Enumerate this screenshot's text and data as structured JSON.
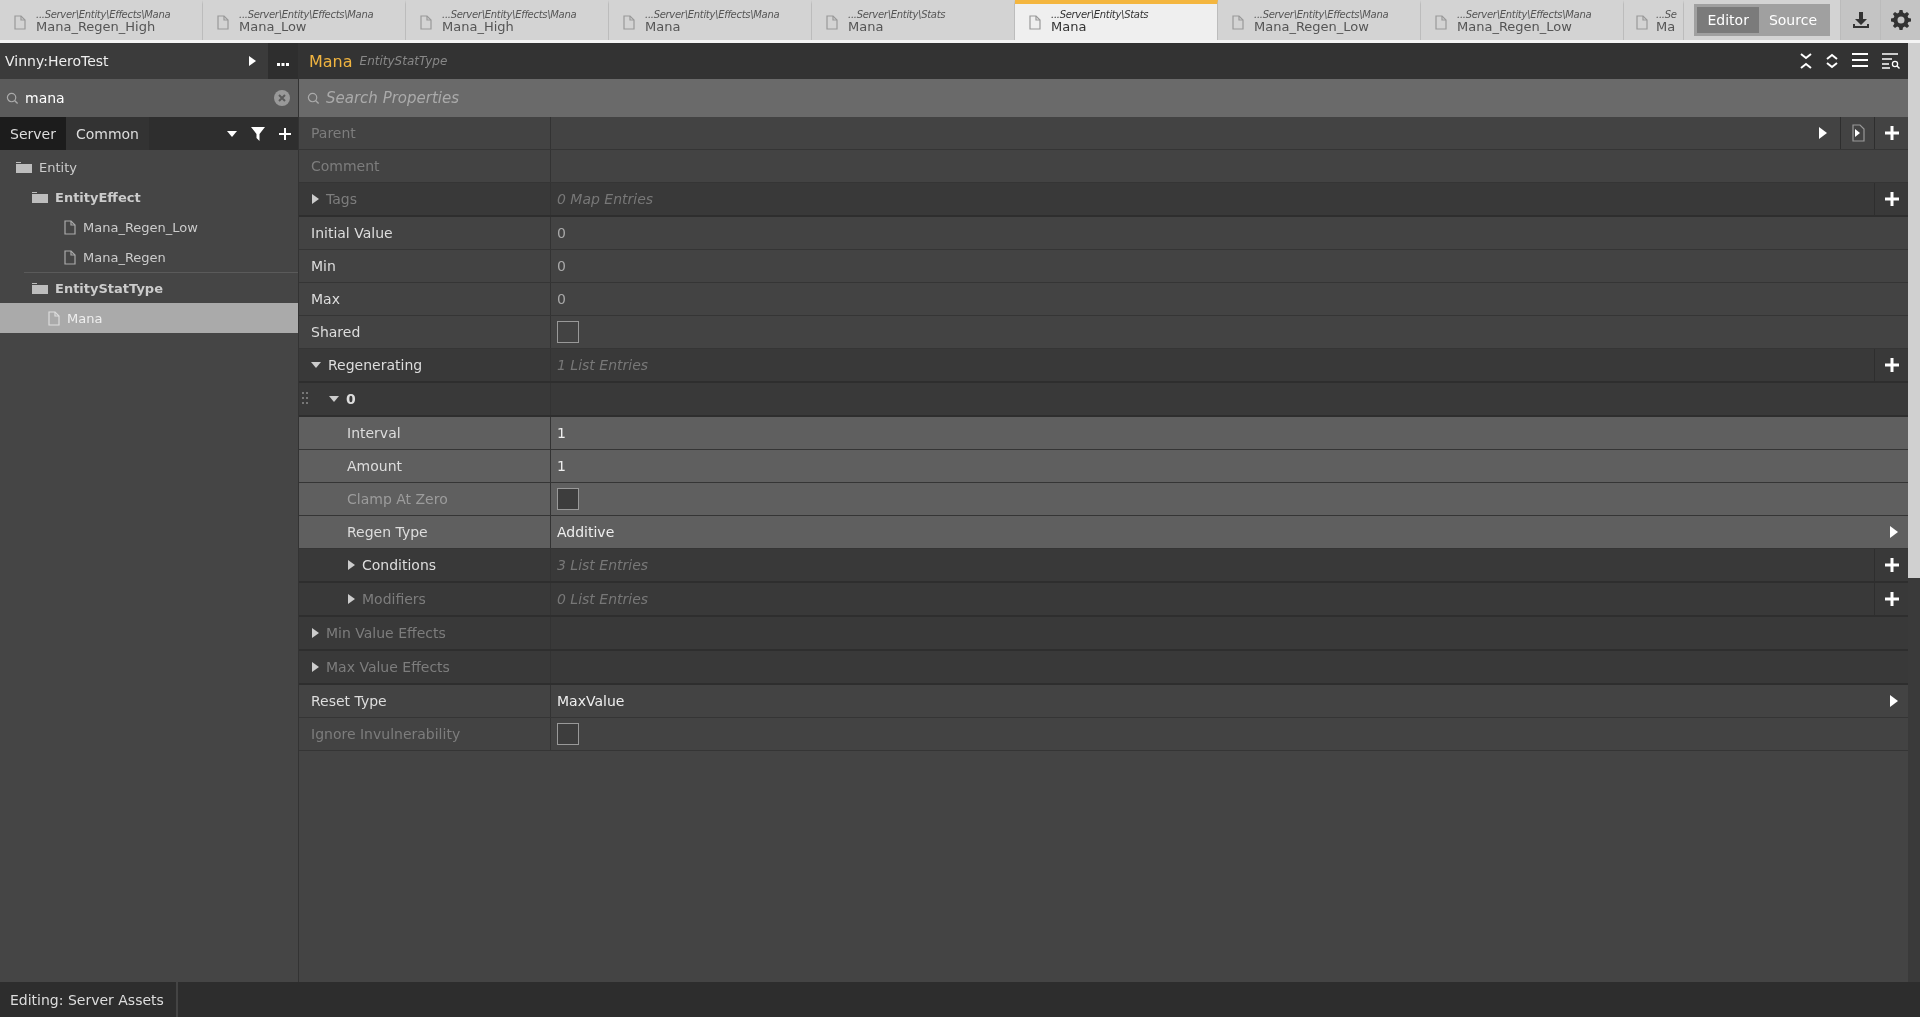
{
  "tabs": [
    {
      "path": "...Server\\Entity\\Effects\\Mana",
      "name": "Mana_Regen_High",
      "selected": false
    },
    {
      "path": "...Server\\Entity\\Effects\\Mana",
      "name": "Mana_Low",
      "selected": false
    },
    {
      "path": "...Server\\Entity\\Effects\\Mana",
      "name": "Mana_High",
      "selected": false
    },
    {
      "path": "...Server\\Entity\\Effects\\Mana",
      "name": "Mana",
      "selected": false
    },
    {
      "path": "...Server\\Entity\\Stats",
      "name": "Mana",
      "selected": false
    },
    {
      "path": "...Server\\Entity\\Stats",
      "name": "Mana",
      "selected": true
    },
    {
      "path": "...Server\\Entity\\Effects\\Mana",
      "name": "Mana_Regen_Low",
      "selected": false
    },
    {
      "path": "...Server\\Entity\\Effects\\Mana",
      "name": "Mana_Regen_Low",
      "selected": false
    },
    {
      "path": "...Se",
      "name": "Ma",
      "selected": false
    }
  ],
  "view_toggle": [
    {
      "label": "Editor",
      "selected": true
    },
    {
      "label": "Source",
      "selected": false
    }
  ],
  "sidebar": {
    "title": "Vinny:HeroTest",
    "search": {
      "value": "mana"
    },
    "source_tabs": [
      {
        "label": "Server",
        "selected": true
      },
      {
        "label": "Common",
        "selected": false
      }
    ],
    "tree": [
      {
        "kind": "folder",
        "label": "Entity",
        "bold": false,
        "selected": false,
        "children": [
          {
            "kind": "folder",
            "label": "EntityEffect",
            "bold": true,
            "selected": false,
            "children": [
              {
                "kind": "file",
                "label": "Mana_Regen_Low",
                "bold": false,
                "selected": false
              },
              {
                "kind": "file",
                "label": "Mana_Regen",
                "bold": false,
                "selected": false
              }
            ]
          },
          {
            "kind": "folder",
            "label": "EntityStatType",
            "bold": true,
            "selected": false,
            "children": [
              {
                "kind": "file",
                "label": "Mana",
                "bold": false,
                "selected": true
              }
            ]
          }
        ]
      }
    ]
  },
  "editor": {
    "title": "Mana",
    "type": "EntityStatType",
    "search": {
      "placeholder": "Search Properties"
    },
    "properties": [
      {
        "kind": "reference",
        "label": "Parent",
        "disabled": true
      },
      {
        "kind": "text",
        "label": "Comment",
        "disabled": true
      },
      {
        "kind": "map",
        "label": "Tags",
        "summary": "0 Map Entries",
        "expanded": false,
        "disabled": true
      },
      {
        "kind": "text",
        "label": "Initial Value",
        "value": "0",
        "default": true,
        "disabled": false
      },
      {
        "kind": "text",
        "label": "Min",
        "value": "0",
        "default": true,
        "disabled": false
      },
      {
        "kind": "text",
        "label": "Max",
        "value": "0",
        "default": true,
        "disabled": false
      },
      {
        "kind": "checkbox",
        "label": "Shared",
        "checked": false,
        "disabled": false
      },
      {
        "kind": "list",
        "label": "Regenerating",
        "summary": "1 List Entries",
        "expanded": true,
        "disabled": false,
        "children": [
          {
            "kind": "item",
            "label": "0",
            "expanded": true,
            "disabled": false,
            "children": [
              {
                "kind": "text",
                "label": "Interval",
                "value": "1",
                "default": false,
                "disabled": false
              },
              {
                "kind": "text",
                "label": "Amount",
                "value": "1",
                "default": false,
                "disabled": false
              },
              {
                "kind": "checkbox",
                "label": "Clamp At Zero",
                "checked": false,
                "disabled": true
              },
              {
                "kind": "enum",
                "label": "Regen Type",
                "value": "Additive",
                "disabled": false
              },
              {
                "kind": "list",
                "label": "Conditions",
                "summary": "3 List Entries",
                "expanded": false,
                "disabled": false
              },
              {
                "kind": "list",
                "label": "Modifiers",
                "summary": "0 List Entries",
                "expanded": false,
                "disabled": true
              }
            ]
          }
        ]
      },
      {
        "kind": "object",
        "label": "Min Value Effects",
        "expanded": false,
        "disabled": true
      },
      {
        "kind": "object",
        "label": "Max Value Effects",
        "expanded": false,
        "disabled": true
      },
      {
        "kind": "enum",
        "label": "Reset Type",
        "value": "MaxValue",
        "disabled": false
      },
      {
        "kind": "checkbox",
        "label": "Ignore Invulnerability",
        "checked": false,
        "disabled": true
      }
    ]
  },
  "status_bar": {
    "text": "Editing: Server Assets"
  }
}
